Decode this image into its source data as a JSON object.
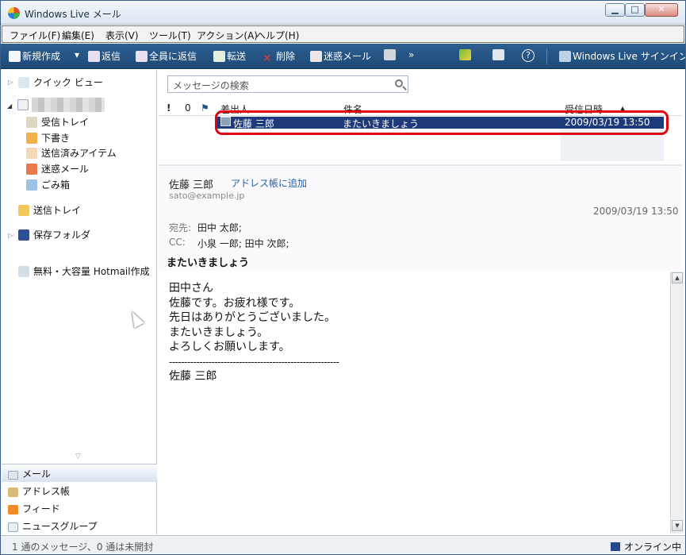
{
  "window": {
    "title": "Windows Live メール"
  },
  "caption_buttons": {
    "minimize": "▁",
    "maximize": "□",
    "close": "✕"
  },
  "menu": [
    "ファイル(F)",
    "編集(E)",
    "表示(V)",
    "ツール(T)",
    "アクション(A)",
    "ヘルプ(H)"
  ],
  "toolbar": {
    "new": "新規作成",
    "new_dropdown": "▾",
    "reply": "返信",
    "reply_all": "全員に返信",
    "forward": "転送",
    "delete": "削除",
    "junk": "迷惑メール",
    "more": "»",
    "signin": "Windows Live サインイン",
    "help": "?"
  },
  "sidebar": {
    "quick_view": "クイック ビュー",
    "folders": [
      "受信トレイ",
      "下書き",
      "送信済みアイテム",
      "迷惑メール",
      "ごみ箱"
    ],
    "outbox": "送信トレイ",
    "storage": "保存フォルダ",
    "hotmail": "無料・大容量 Hotmail作成",
    "nav": [
      "メール",
      "アドレス帳",
      "フィード",
      "ニュースグループ"
    ]
  },
  "search": {
    "placeholder": "メッセージの検索"
  },
  "list": {
    "columns": [
      "!",
      "0",
      "⚑",
      "差出人",
      "件名",
      "受信日時"
    ],
    "sort_indicator": "▲",
    "rows": [
      {
        "from": "佐藤 三郎",
        "subject": "またいきましょう",
        "date": "2009/03/19 13:50"
      }
    ]
  },
  "preview": {
    "from_name": "佐藤 三郎",
    "add_contact": "アドレス帳に追加",
    "from_email": "sato@example.jp",
    "date": "2009/03/19 13:50",
    "to_label": "宛先:",
    "to": "田中 太郎;",
    "cc_label": "CC:",
    "cc": "小泉 一郎; 田中 次郎;",
    "subject": "またいきましょう"
  },
  "body_lines": [
    "田中さん",
    "",
    "佐藤です。お疲れ様です。",
    "",
    "先日はありがとうございました。",
    "またいきましょう。",
    "",
    "よろしくお願いします。",
    "",
    "--------------------------------------------------------",
    "佐藤 三郎"
  ],
  "status": {
    "left": "1 通のメッセージ、0 通は未開封",
    "right": "オンライン中"
  }
}
